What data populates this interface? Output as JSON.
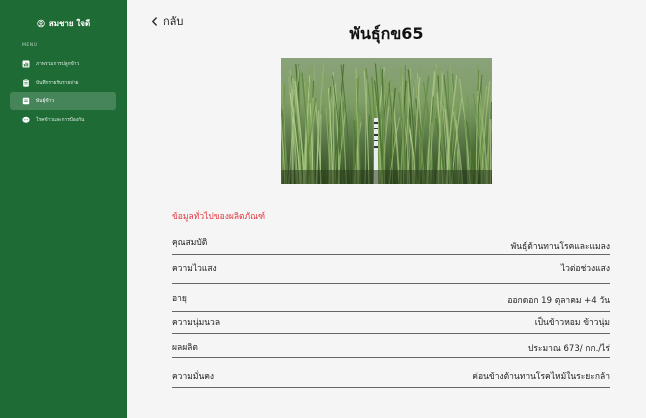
{
  "sidebar": {
    "user_name": "สมชาย ใจดี",
    "menu_heading": "MENU",
    "items": [
      {
        "label": "ภาพรวมการปลูกข้าว",
        "icon": "chart-icon",
        "active": false
      },
      {
        "label": "บันทึกรายรับรายจ่าย",
        "icon": "clipboard-icon",
        "active": false
      },
      {
        "label": "พันธุ์ข้าว",
        "icon": "book-icon",
        "active": true
      },
      {
        "label": "โรคข้าวและการป้องกัน",
        "icon": "chat-icon",
        "active": false
      }
    ]
  },
  "header": {
    "back_label": "กลับ",
    "title": "พันธุ์กข65"
  },
  "image": {
    "alt": "rice-field-photo"
  },
  "details": {
    "section_title": "ข้อมูลทั่วไปของผลิตภัณฑ์",
    "rows": [
      {
        "key": "คุณสมบัติ",
        "value": "พันธุ์ต้านทานโรคและแมลง"
      },
      {
        "key": "ความไวแสง",
        "value": "ไวต่อช่วงแสง"
      },
      {
        "key": "อายุ",
        "value": "ออกดอก 19 ตุลาคม +4 วัน"
      },
      {
        "key": "ความนุ่มนวล",
        "value": "เป็นข้าวหอม ข้าวนุ่ม"
      },
      {
        "key": "ผลผลิต",
        "value": "ประมาณ 673/ กก./ไร่"
      },
      {
        "key": "ความมั่นคง",
        "value": "ค่อนข้างต้านทานโรคไหม้ในระยะกล้า"
      }
    ]
  },
  "colors": {
    "sidebar_bg": "#1e6b35",
    "section_title": "#e2363f"
  }
}
